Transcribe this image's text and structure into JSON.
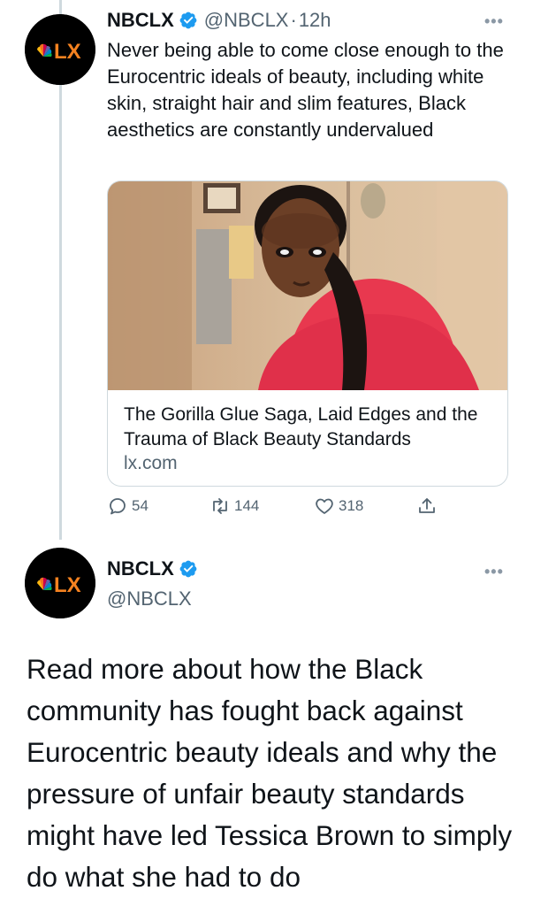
{
  "tweet1": {
    "author_name": "NBCLX",
    "handle": "@NBCLX",
    "separator": "·",
    "time": "12h",
    "more_label": "•••",
    "avatar_logo_text": "LX",
    "text": "Never being able to come close enough to the Eurocentric ideals of beauty, including white skin, straight hair and slim features, Black aesthetics are constantly undervalued",
    "card": {
      "title": "The Gorilla Glue Saga, Laid Edges and the Trauma of Black Beauty Standards",
      "domain": "lx.com"
    },
    "actions": {
      "reply_count": "54",
      "retweet_count": "144",
      "like_count": "318"
    }
  },
  "tweet2": {
    "author_name": "NBCLX",
    "handle": "@NBCLX",
    "more_label": "•••",
    "avatar_logo_text": "LX",
    "text": "Read more about how the Black community has fought back against Eurocentric beauty ideals and why the pressure of unfair beauty standards might have led Tessica Brown to simply do what she had to do"
  },
  "colors": {
    "verified_blue": "#1d9bf0",
    "logo_orange": "#f58220",
    "secondary_text": "#536471"
  }
}
